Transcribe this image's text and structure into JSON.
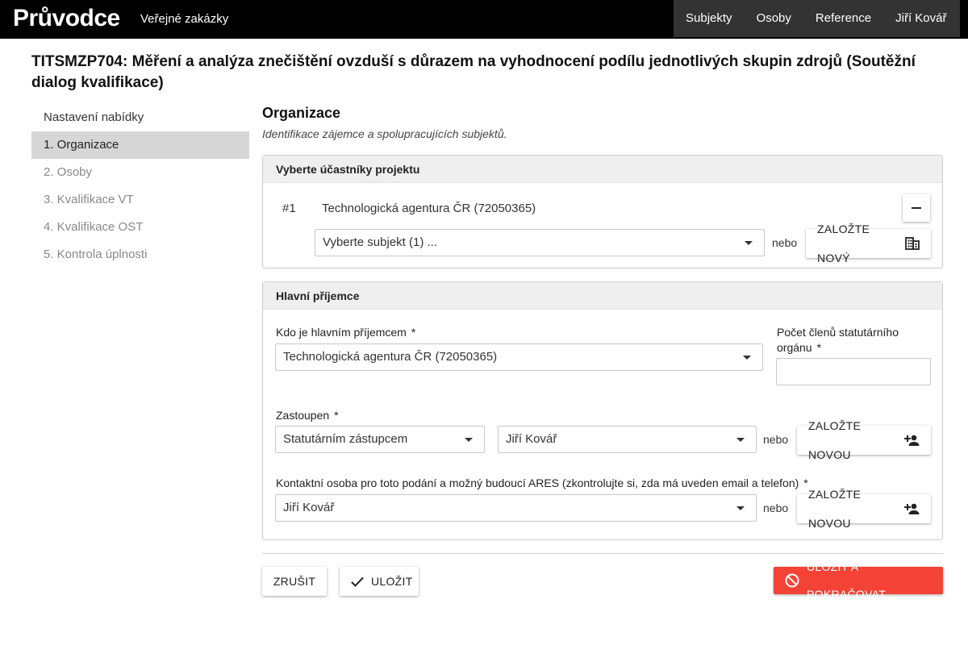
{
  "header": {
    "brand": "Průvodce",
    "section": "Veřejné zakázky",
    "nav": [
      "Subjekty",
      "Osoby",
      "Reference",
      "Jiří Kovář"
    ]
  },
  "page_title": "TITSMZP704: Měření a analýza znečištění ovzduší s důrazem na vyhodnocení podílu jednotlivých skupin zdrojů (Soutěžní dialog kvalifikace)",
  "sidebar": {
    "heading": "Nastavení nabídky",
    "items": [
      {
        "label": "1. Organizace",
        "active": true
      },
      {
        "label": "2. Osoby"
      },
      {
        "label": "3. Kvalifikace VT"
      },
      {
        "label": "4. Kvalifikace OST"
      },
      {
        "label": "5. Kontrola úplnosti"
      }
    ]
  },
  "main": {
    "title": "Organizace",
    "subtitle": "Identifikace zájemce a spolupracujících subjektů.",
    "participants": {
      "heading": "Vyberte účastníky projektu",
      "row_number": "#1",
      "row_name": "Technologická agentura ČR (72050365)",
      "remove_label": "−",
      "select_placeholder": "Vyberte subjekt (1) ...",
      "or": "nebo",
      "create_new": "ZALOŽTE NOVÝ"
    },
    "recipient": {
      "heading": "Hlavní příjemce",
      "who_label": "Kdo je hlavním příjemcem",
      "who_value": "Technologická agentura ČR (72050365)",
      "count_label_1": "Počet členů statutárního",
      "count_label_2": "orgánu",
      "count_value": "",
      "asterisk": "*",
      "represented_label": "Zastoupen",
      "represented_by": "Statutárním zástupcem",
      "represented_person": "Jiří Kovář",
      "or": "nebo",
      "create_new": "ZALOŽTE NOVOU",
      "contact_label": "Kontaktní osoba pro toto podání a možný budoucí ARES (zkontrolujte si, zda má uveden email a telefon)",
      "contact_value": "Jiří Kovář"
    }
  },
  "actions": {
    "cancel": "ZRUŠIT",
    "save": "ULOŽIT",
    "save_continue": "ULOŽIT A POKRAČOVAT"
  },
  "colors": {
    "topbar": "#000000",
    "nav_bg": "#333333",
    "active_item": "#d6d6d6",
    "danger": "#f44336"
  }
}
